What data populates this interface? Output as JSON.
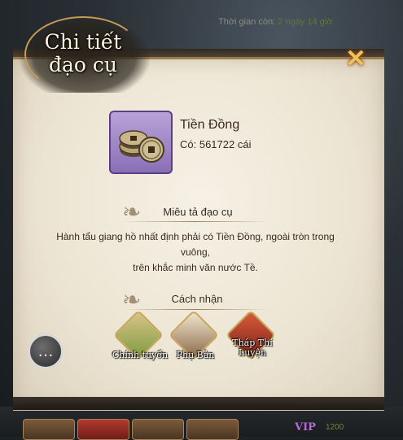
{
  "header": {
    "title_line1": "Chi tiết",
    "title_line2": "đạo cụ",
    "timer_label": "Thời gian còn: ",
    "timer_value": "2 ngày 14 giờ",
    "close_glyph": "✕"
  },
  "item": {
    "name": "Tiền Đồng",
    "count_text": "Có: 561722 cái",
    "icon": "copper-coins-icon"
  },
  "description": {
    "heading": "Miêu tả đạo cụ",
    "line1": "Hành tẩu giang hồ nhất định phải có Tiền Đồng, ngoài tròn trong vuông,",
    "line2": "trên khắc minh văn nước Tề."
  },
  "sources": {
    "heading": "Cách nhận",
    "items": [
      {
        "label": "Chính tuyến",
        "icon": "scroll-bundle-icon"
      },
      {
        "label": "Phụ Bản",
        "icon": "book-map-icon"
      },
      {
        "label": "Tháp Thí Luyện",
        "icon": "tower-icon"
      }
    ]
  },
  "footer": {
    "vip_label": "VIP",
    "vip_value": "1200"
  },
  "colors": {
    "panel_bg": "#ece4d2",
    "item_frame": "#8a6fb6",
    "close_gold": "#f0c35a",
    "text_dark": "#3a2a20"
  }
}
